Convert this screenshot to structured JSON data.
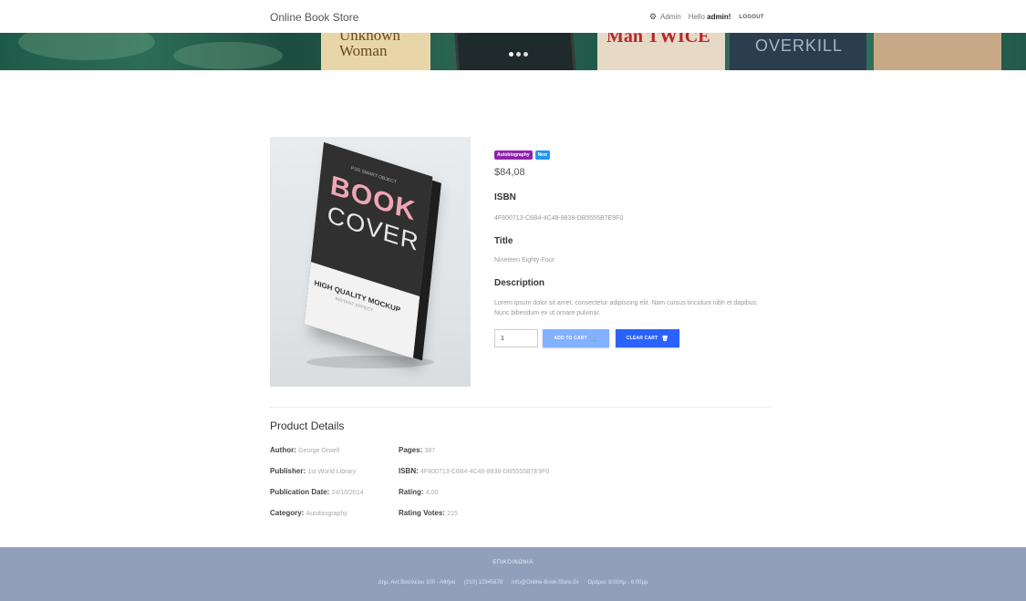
{
  "header": {
    "brand": "Online Book Store",
    "admin_label": "Admin",
    "hello_prefix": "Hello",
    "user": "admin!",
    "logout": "LOGOUT"
  },
  "banner": {
    "book1_title_line1": "Unknown",
    "book1_title_line2": "Woman",
    "book3_title": "TWICE",
    "book3_partial": "Man",
    "book4_title": "OVERKILL"
  },
  "product": {
    "image": {
      "small_text": "PSD SMART OBJECT",
      "title_big": "BOOK",
      "title_second": "COVER",
      "mockup_line1": "HIGH QUALITY MOCKUP",
      "mockup_line2": "INSTANT EFFECT"
    },
    "badges": {
      "category": "Autobiography",
      "new": "New"
    },
    "price": "$84,08",
    "isbn_label": "ISBN",
    "isbn_value": "4F800713-C6B4-4C48-8838-DB5555B7E9F0",
    "title_label": "Title",
    "title_value": "Nineteen Eighty-Four",
    "description_label": "Description",
    "description_value": "Lorem ipsum dolor sit amet, consectetur adipiscing elit. Nam cursus tincidunt nibh et dapibus. Nunc bibendum ex ut ornare pulvinar.",
    "quantity": "1",
    "add_to_cart": "ADD TO CART",
    "clear_cart": "CLEAR CART"
  },
  "details": {
    "heading": "Product Details",
    "author_label": "Author:",
    "author_value": "George Orwell",
    "publisher_label": "Publisher:",
    "publisher_value": "1st World Library",
    "pubdate_label": "Publication Date:",
    "pubdate_value": "24/10/2014",
    "category_label": "Category:",
    "category_value": "Autobiography",
    "pages_label": "Pages:",
    "pages_value": "387",
    "isbn_label": "ISBN:",
    "isbn_value": "4F800713-C6B4-4C48-8838-DB5555B7E9F0",
    "rating_label": "Rating:",
    "rating_value": "4,00",
    "votes_label": "Rating Votes:",
    "votes_value": "215"
  },
  "footer": {
    "title": "ΕΠΙΚΟΙΝΩΝΙΑ",
    "address": "Δημ. Αντ.Βασιλείου 100 - Αθήνα",
    "phone": "(210) 12345678",
    "email": "Info@Online-Book-Store.Gr",
    "hours": "Ωράριο: 8:00πμ - 6:00μμ"
  },
  "colors": {
    "badge_category": "#8e24aa",
    "badge_new": "#2196f3",
    "add_button": "#82b1ff",
    "clear_button": "#2962ff",
    "footer_bg": "#919fbb"
  }
}
